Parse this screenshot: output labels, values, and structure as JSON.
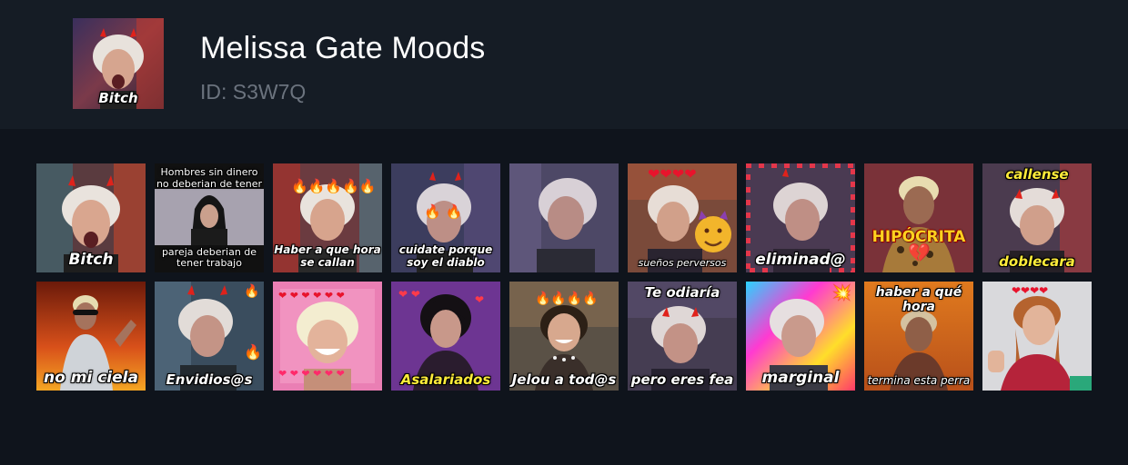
{
  "pack": {
    "title": "Melissa Gate Moods",
    "id_label": "ID: S3W7Q",
    "thumb_caption": "Bitch"
  },
  "stickers": [
    {
      "caption": "Bitch"
    },
    {
      "caption_top": "Hombres sin dinero no deberian de tener",
      "caption_bottom": "pareja deberian de tener trabajo"
    },
    {
      "caption": "Haber a que hora se callan"
    },
    {
      "caption": "cuidate porque soy el diablo"
    },
    {
      "caption": ""
    },
    {
      "caption": "sueños perversos"
    },
    {
      "caption": "eliminad@"
    },
    {
      "caption": "HIPÓCRITA"
    },
    {
      "caption_top": "callense",
      "caption_bottom": "doblecara"
    },
    {
      "caption": "no mi ciela"
    },
    {
      "caption": "Envidios@s"
    },
    {
      "caption": ""
    },
    {
      "caption": "Asalariados"
    },
    {
      "caption": "Jelou a tod@s"
    },
    {
      "caption_top": "Te odiaría",
      "caption_bottom": "pero eres fea"
    },
    {
      "caption": "marginal"
    },
    {
      "caption_top": "haber a qué hora",
      "caption_bottom": "termina esta perra"
    },
    {
      "caption": ""
    }
  ],
  "colors": {
    "page_bg": "#0f141c",
    "header_bg": "#151c25",
    "title": "#ffffff",
    "id_text": "#6b737e"
  }
}
